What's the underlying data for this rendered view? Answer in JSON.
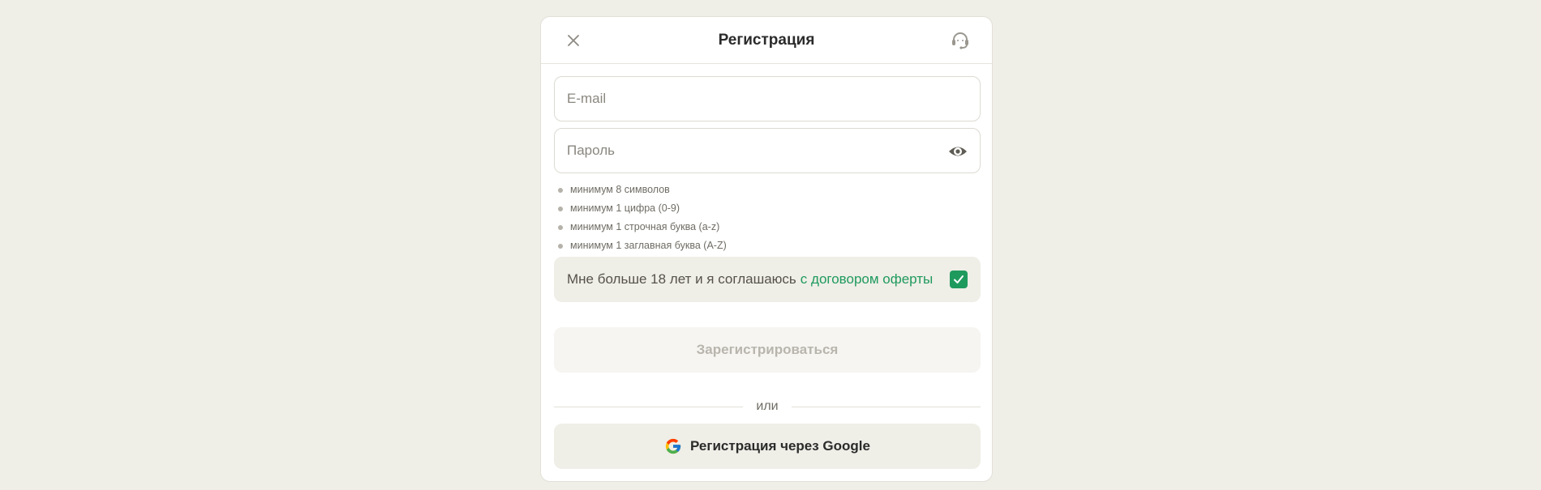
{
  "dialog": {
    "title": "Регистрация",
    "close_icon": "close-icon",
    "support_icon": "headset-icon"
  },
  "form": {
    "email": {
      "placeholder": "E-mail",
      "value": ""
    },
    "password": {
      "placeholder": "Пароль",
      "value": "",
      "toggle_icon": "eye-icon"
    },
    "rules": [
      "минимум 8 символов",
      "минимум 1 цифра (0-9)",
      "минимум 1 строчная буква (a-z)",
      "минимум 1 заглавная буква (A-Z)"
    ],
    "agreement": {
      "text": "Мне больше 18 лет и я соглашаюсь",
      "link": "с договором оферты",
      "checked": true
    },
    "submit_label": "Зарегистрироваться",
    "divider_text": "или",
    "google_label": "Регистрация через Google"
  },
  "colors": {
    "accent": "#1f9a5d",
    "background": "#efeee7",
    "card": "#ffffff"
  }
}
